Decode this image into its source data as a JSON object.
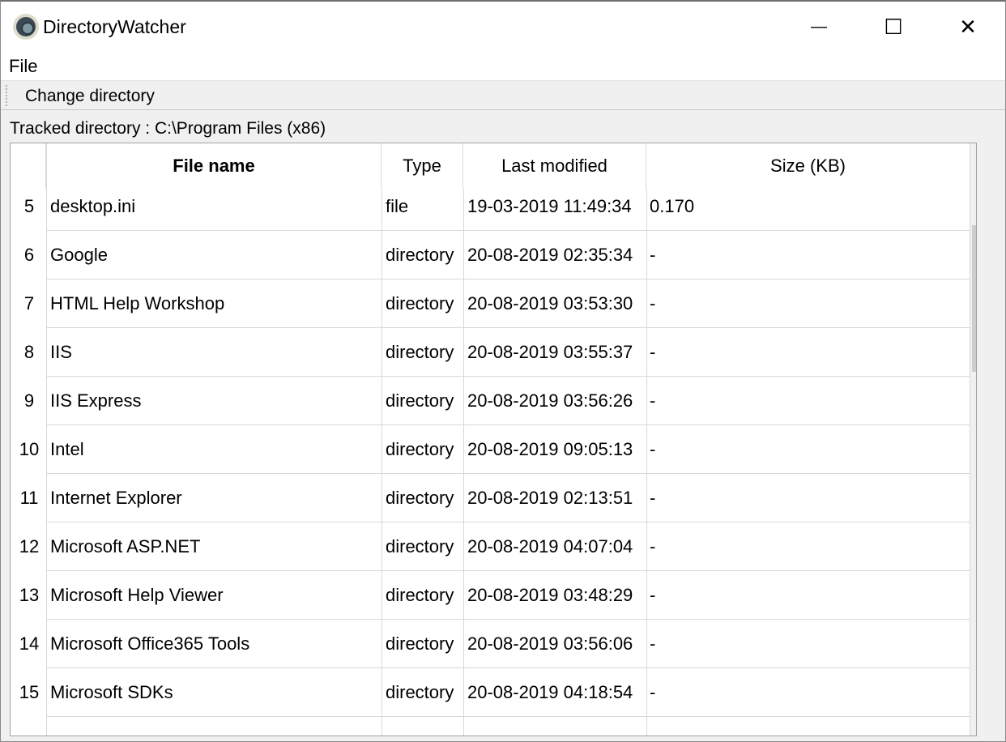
{
  "window": {
    "title": "DirectoryWatcher",
    "minimize": "—",
    "maximize": "☐",
    "close": "✕"
  },
  "menu": {
    "file": "File"
  },
  "toolbar": {
    "change_directory": "Change directory"
  },
  "tracked_label": "Tracked directory : C:\\Program Files (x86)",
  "table": {
    "headers": [
      "File name",
      "Type",
      "Last modified",
      "Size (KB)"
    ],
    "rows": [
      {
        "n": "5",
        "name": "desktop.ini",
        "type": "file",
        "modified": "19-03-2019 11:49:34",
        "size": "0.170"
      },
      {
        "n": "6",
        "name": "Google",
        "type": "directory",
        "modified": "20-08-2019 02:35:34",
        "size": "-"
      },
      {
        "n": "7",
        "name": "HTML Help Workshop",
        "type": "directory",
        "modified": "20-08-2019 03:53:30",
        "size": "-"
      },
      {
        "n": "8",
        "name": "IIS",
        "type": "directory",
        "modified": "20-08-2019 03:55:37",
        "size": "-"
      },
      {
        "n": "9",
        "name": "IIS Express",
        "type": "directory",
        "modified": "20-08-2019 03:56:26",
        "size": "-"
      },
      {
        "n": "10",
        "name": "Intel",
        "type": "directory",
        "modified": "20-08-2019 09:05:13",
        "size": "-"
      },
      {
        "n": "11",
        "name": "Internet Explorer",
        "type": "directory",
        "modified": "20-08-2019 02:13:51",
        "size": "-"
      },
      {
        "n": "12",
        "name": "Microsoft ASP.NET",
        "type": "directory",
        "modified": "20-08-2019 04:07:04",
        "size": "-"
      },
      {
        "n": "13",
        "name": "Microsoft Help Viewer",
        "type": "directory",
        "modified": "20-08-2019 03:48:29",
        "size": "-"
      },
      {
        "n": "14",
        "name": "Microsoft Office365 Tools",
        "type": "directory",
        "modified": "20-08-2019 03:56:06",
        "size": "-"
      },
      {
        "n": "15",
        "name": "Microsoft SDKs",
        "type": "directory",
        "modified": "20-08-2019 04:18:54",
        "size": "-"
      }
    ]
  }
}
